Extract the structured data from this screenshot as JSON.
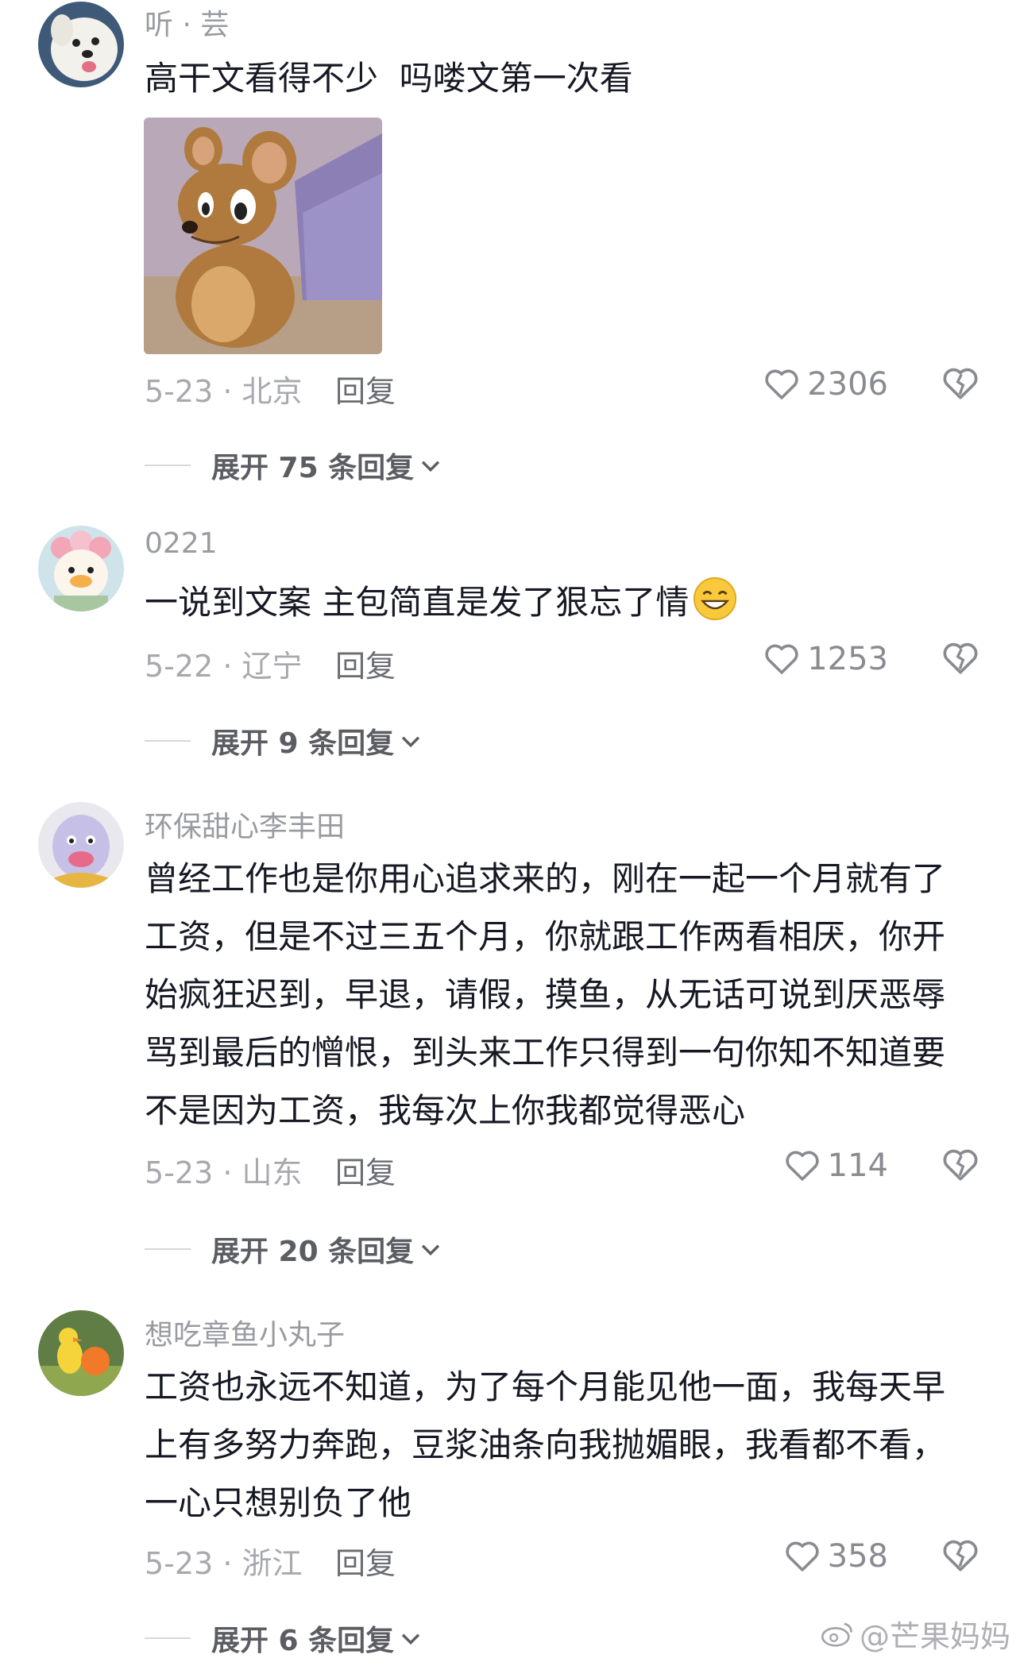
{
  "comments": [
    {
      "username": "听 · 芸",
      "text": "高干文看得不少  吗喽文第一次看",
      "meta": "5-23 · 北京",
      "reply_label": "回复",
      "likes": "2306",
      "expand": "展开 75 条回复"
    },
    {
      "username": "0221",
      "text": "一说到文案 主包简直是发了狠忘了情",
      "meta": "5-22 · 辽宁",
      "reply_label": "回复",
      "likes": "1253",
      "expand": "展开 9 条回复"
    },
    {
      "username": "环保甜心李丰田",
      "text": "曾经工作也是你用心追求来的，刚在一起一个月就有了工资，但是不过三五个月，你就跟工作两看相厌，你开始疯狂迟到，早退，请假，摸鱼，从无话可说到厌恶辱骂到最后的憎恨，到头来工作只得到一句你知不知道要不是因为工资，我每次上你我都觉得恶心",
      "meta": "5-23 · 山东",
      "reply_label": "回复",
      "likes": "114",
      "expand": "展开 20 条回复"
    },
    {
      "username": "想吃章鱼小丸子",
      "text": "工资也永远不知道，为了每个月能见他一面，我每天早上有多努力奔跑，豆浆油条向我抛媚眼，我看都不看，一心只想别负了他",
      "meta": "5-23 · 浙江",
      "reply_label": "回复",
      "likes": "358",
      "expand": "展开 6 条回复"
    }
  ],
  "watermark": "@芒果妈妈",
  "icons": {
    "like": "heart-outline-icon",
    "dislike": "broken-heart-icon",
    "expand": "chevron-down-icon",
    "emoji": "grinning-face-emoji",
    "watermark": "weibo-logo-icon"
  },
  "colors": {
    "text": "#161823",
    "meta": "#a8a9ae",
    "username": "#9a9ba1",
    "reply": "#6b6c72"
  }
}
